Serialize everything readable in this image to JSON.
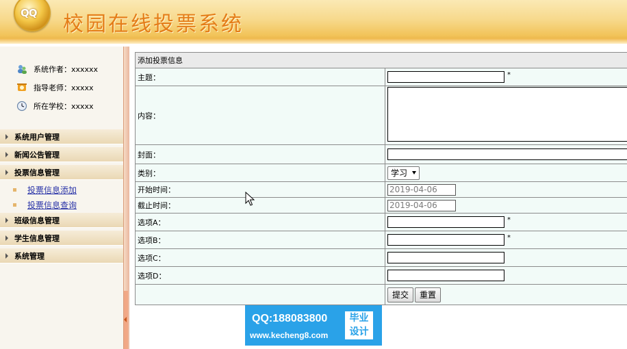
{
  "header": {
    "logo_text": "QQ",
    "title": "校园在线投票系统"
  },
  "sidebar": {
    "info": [
      {
        "label": "系统作者：xxxxxx",
        "icon": "users-icon"
      },
      {
        "label": "指导老师：xxxxx",
        "icon": "teacher-icon"
      },
      {
        "label": "所在学校：xxxxx",
        "icon": "clock-icon"
      }
    ],
    "menu": [
      {
        "label": "系统用户管理"
      },
      {
        "label": "新闻公告管理"
      },
      {
        "label": "投票信息管理"
      },
      {
        "label": "班级信息管理"
      },
      {
        "label": "学生信息管理"
      },
      {
        "label": "系统管理"
      }
    ],
    "submenu": [
      {
        "label": "投票信息添加"
      },
      {
        "label": "投票信息查询"
      }
    ]
  },
  "form": {
    "caption": "添加投票信息",
    "fields": {
      "subject": {
        "label": "主题：",
        "value": "",
        "required": "*"
      },
      "content": {
        "label": "内容：",
        "value": ""
      },
      "cover": {
        "label": "封面：",
        "value": ""
      },
      "category": {
        "label": "类别：",
        "value": "学习"
      },
      "start_time": {
        "label": "开始时间：",
        "value": "2019-04-06"
      },
      "end_time": {
        "label": "截止时间：",
        "value": "2019-04-06"
      },
      "option_a": {
        "label": "选项A：",
        "value": "",
        "required": "*"
      },
      "option_b": {
        "label": "选项B：",
        "value": "",
        "required": "*"
      },
      "option_c": {
        "label": "选项C：",
        "value": ""
      },
      "option_d": {
        "label": "选项D：",
        "value": ""
      }
    },
    "submit_label": "提交",
    "reset_label": "重置"
  },
  "watermark": {
    "qq": "QQ:188083800",
    "url": "www.kecheng8.com",
    "badge_line1": "毕业",
    "badge_line2": "设计"
  },
  "colors": {
    "title": "#e47d18",
    "header_bg": "#f2c45a",
    "form_bg": "#f2fbf8",
    "watermark_bg": "#2aa2e8",
    "link": "#2a34a8"
  }
}
